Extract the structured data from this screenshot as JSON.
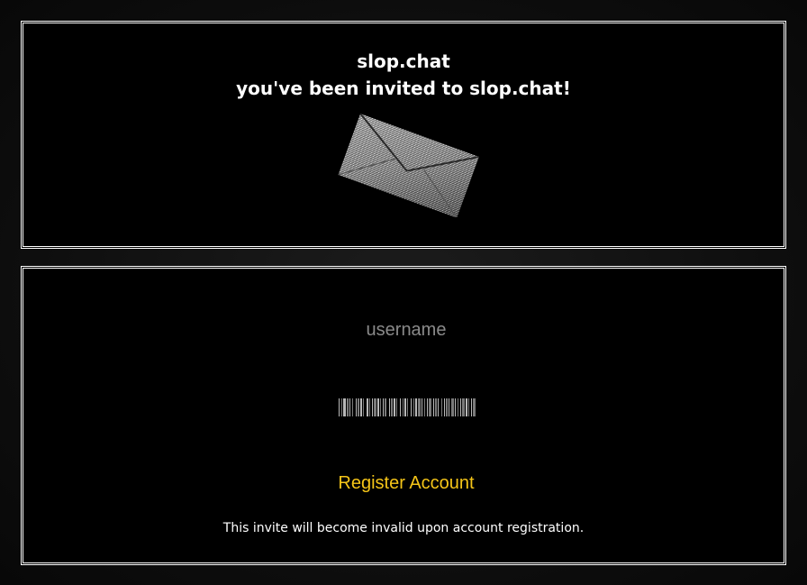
{
  "invite": {
    "site_name": "slop.chat",
    "heading": "you've been invited to slop.chat!",
    "image_icon": "envelope-icon"
  },
  "register": {
    "username_placeholder": "username",
    "username_value": "",
    "captcha_icon": "barcode-icon",
    "button_label": "Register Account",
    "note": "This invite will become invalid upon account registration."
  },
  "colors": {
    "background": "#000000",
    "border": "#ffffff",
    "accent": "#f5c518",
    "placeholder": "#8a8a8a"
  }
}
